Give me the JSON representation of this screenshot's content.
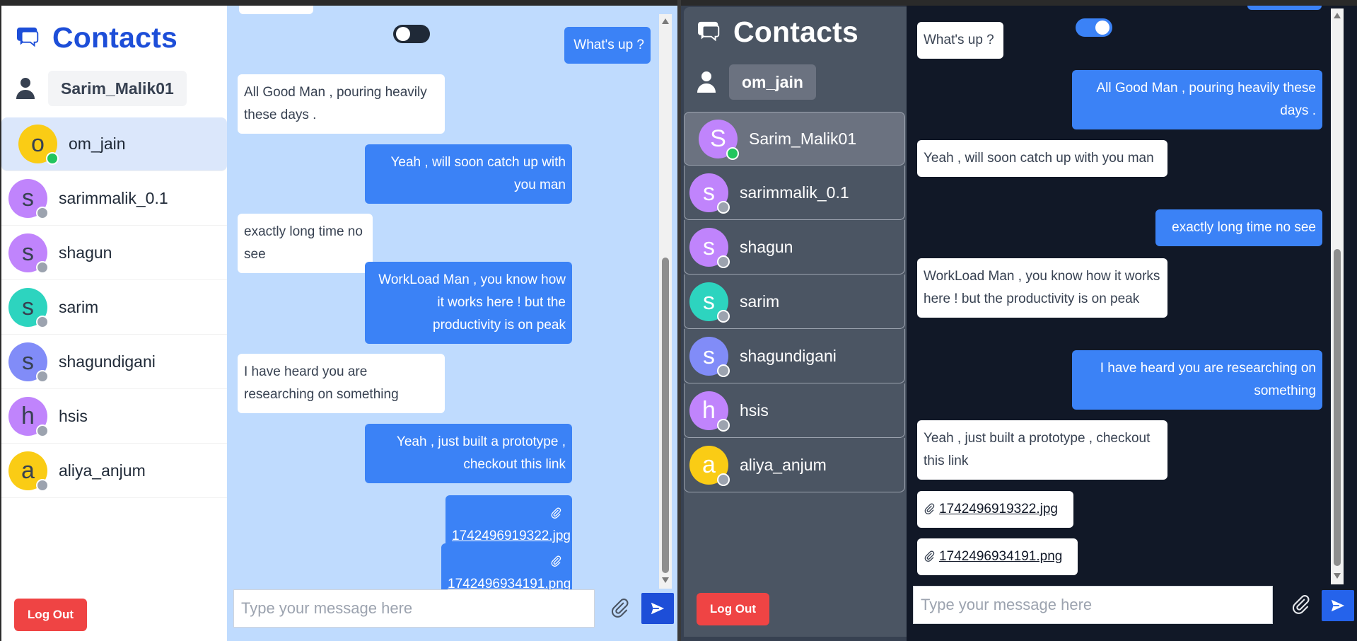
{
  "colors": {
    "brand_blue": "#1d4ed8",
    "bubble_out": "#3b82f6",
    "logout_red": "#ef4444",
    "online": "#22c55e",
    "offline": "#9ca3af"
  },
  "icons": {
    "brand": "chat-bubbles-icon",
    "user": "user-icon",
    "attach": "paperclip-icon",
    "send": "send-arrow-icon"
  },
  "light": {
    "title": "Contacts",
    "current_user": "Sarim_Malik01",
    "theme_toggle_on": false,
    "contacts": [
      {
        "initial": "o",
        "name": "om_jain",
        "color": "#facc15",
        "online": true,
        "selected": true
      },
      {
        "initial": "s",
        "name": "sarimmalik_0.1",
        "color": "#c084fc",
        "online": false
      },
      {
        "initial": "s",
        "name": "shagun",
        "color": "#c084fc",
        "online": false
      },
      {
        "initial": "s",
        "name": "sarim",
        "color": "#2dd4bf",
        "online": false
      },
      {
        "initial": "s",
        "name": "shagundigani",
        "color": "#818cf8",
        "online": false
      },
      {
        "initial": "h",
        "name": "hsis",
        "color": "#c084fc",
        "online": false
      },
      {
        "initial": "a",
        "name": "aliya_anjum",
        "color": "#facc15",
        "online": false
      }
    ],
    "logout_label": "Log Out",
    "messages": [
      {
        "dir": "out",
        "text": "What's up ?"
      },
      {
        "dir": "in",
        "text": "All Good Man , pouring heavily these days ."
      },
      {
        "dir": "out",
        "text": "Yeah , will soon catch up with you man"
      },
      {
        "dir": "in",
        "text": "exactly long time no see"
      },
      {
        "dir": "out",
        "text": "WorkLoad Man , you know how it works here ! but the productivity is on peak"
      },
      {
        "dir": "in",
        "text": "I have heard you are researching on something"
      },
      {
        "dir": "out",
        "text": "Yeah , just built a prototype , checkout this link"
      },
      {
        "dir": "out",
        "file": "1742496919322.jpg"
      },
      {
        "dir": "out",
        "file": "1742496934191.png"
      }
    ],
    "input_placeholder": "Type your message here"
  },
  "dark": {
    "title": "Contacts",
    "current_user": "om_jain",
    "theme_toggle_on": true,
    "contacts": [
      {
        "initial": "S",
        "name": "Sarim_Malik01",
        "color": "#c084fc",
        "online": true,
        "selected": true
      },
      {
        "initial": "s",
        "name": "sarimmalik_0.1",
        "color": "#c084fc",
        "online": false
      },
      {
        "initial": "s",
        "name": "shagun",
        "color": "#c084fc",
        "online": false
      },
      {
        "initial": "s",
        "name": "sarim",
        "color": "#2dd4bf",
        "online": false
      },
      {
        "initial": "s",
        "name": "shagundigani",
        "color": "#818cf8",
        "online": false
      },
      {
        "initial": "h",
        "name": "hsis",
        "color": "#c084fc",
        "online": false
      },
      {
        "initial": "a",
        "name": "aliya_anjum",
        "color": "#facc15",
        "online": false
      }
    ],
    "logout_label": "Log Out",
    "messages": [
      {
        "dir": "in",
        "text": "What's up ?"
      },
      {
        "dir": "out",
        "text": "All Good Man , pouring heavily these days ."
      },
      {
        "dir": "in",
        "text": "Yeah , will soon catch up with you man"
      },
      {
        "dir": "out",
        "text": "exactly long time no see"
      },
      {
        "dir": "in",
        "text": "WorkLoad Man , you know how it works here ! but the productivity is on peak"
      },
      {
        "dir": "out",
        "text": "I have heard you are researching on something"
      },
      {
        "dir": "in",
        "text": "Yeah , just built a prototype , checkout this link"
      },
      {
        "dir": "in",
        "file": "1742496919322.jpg"
      },
      {
        "dir": "in",
        "file": "1742496934191.png"
      }
    ],
    "input_placeholder": "Type your message here"
  }
}
